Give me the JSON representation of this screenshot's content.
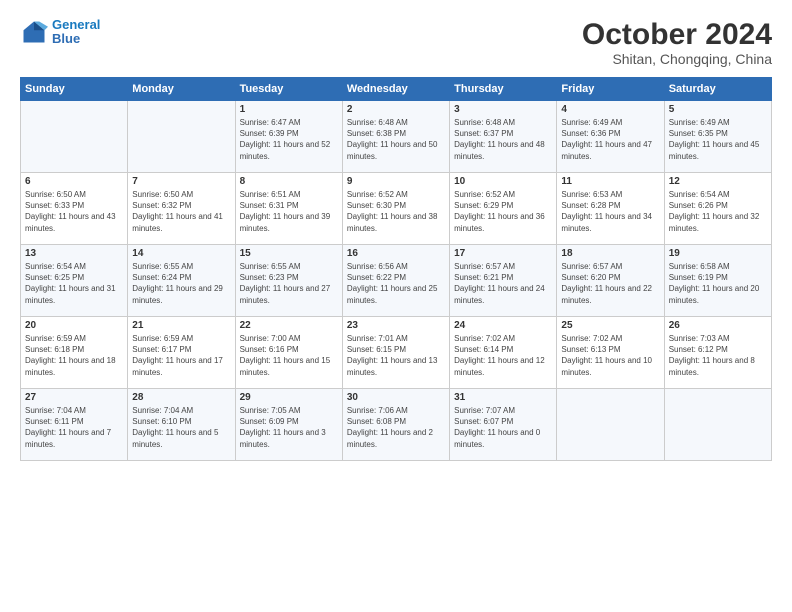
{
  "header": {
    "logo_line1": "General",
    "logo_line2": "Blue",
    "title": "October 2024",
    "subtitle": "Shitan, Chongqing, China"
  },
  "days_of_week": [
    "Sunday",
    "Monday",
    "Tuesday",
    "Wednesday",
    "Thursday",
    "Friday",
    "Saturday"
  ],
  "weeks": [
    [
      {
        "day": "",
        "info": ""
      },
      {
        "day": "",
        "info": ""
      },
      {
        "day": "1",
        "info": "Sunrise: 6:47 AM\nSunset: 6:39 PM\nDaylight: 11 hours and 52 minutes."
      },
      {
        "day": "2",
        "info": "Sunrise: 6:48 AM\nSunset: 6:38 PM\nDaylight: 11 hours and 50 minutes."
      },
      {
        "day": "3",
        "info": "Sunrise: 6:48 AM\nSunset: 6:37 PM\nDaylight: 11 hours and 48 minutes."
      },
      {
        "day": "4",
        "info": "Sunrise: 6:49 AM\nSunset: 6:36 PM\nDaylight: 11 hours and 47 minutes."
      },
      {
        "day": "5",
        "info": "Sunrise: 6:49 AM\nSunset: 6:35 PM\nDaylight: 11 hours and 45 minutes."
      }
    ],
    [
      {
        "day": "6",
        "info": "Sunrise: 6:50 AM\nSunset: 6:33 PM\nDaylight: 11 hours and 43 minutes."
      },
      {
        "day": "7",
        "info": "Sunrise: 6:50 AM\nSunset: 6:32 PM\nDaylight: 11 hours and 41 minutes."
      },
      {
        "day": "8",
        "info": "Sunrise: 6:51 AM\nSunset: 6:31 PM\nDaylight: 11 hours and 39 minutes."
      },
      {
        "day": "9",
        "info": "Sunrise: 6:52 AM\nSunset: 6:30 PM\nDaylight: 11 hours and 38 minutes."
      },
      {
        "day": "10",
        "info": "Sunrise: 6:52 AM\nSunset: 6:29 PM\nDaylight: 11 hours and 36 minutes."
      },
      {
        "day": "11",
        "info": "Sunrise: 6:53 AM\nSunset: 6:28 PM\nDaylight: 11 hours and 34 minutes."
      },
      {
        "day": "12",
        "info": "Sunrise: 6:54 AM\nSunset: 6:26 PM\nDaylight: 11 hours and 32 minutes."
      }
    ],
    [
      {
        "day": "13",
        "info": "Sunrise: 6:54 AM\nSunset: 6:25 PM\nDaylight: 11 hours and 31 minutes."
      },
      {
        "day": "14",
        "info": "Sunrise: 6:55 AM\nSunset: 6:24 PM\nDaylight: 11 hours and 29 minutes."
      },
      {
        "day": "15",
        "info": "Sunrise: 6:55 AM\nSunset: 6:23 PM\nDaylight: 11 hours and 27 minutes."
      },
      {
        "day": "16",
        "info": "Sunrise: 6:56 AM\nSunset: 6:22 PM\nDaylight: 11 hours and 25 minutes."
      },
      {
        "day": "17",
        "info": "Sunrise: 6:57 AM\nSunset: 6:21 PM\nDaylight: 11 hours and 24 minutes."
      },
      {
        "day": "18",
        "info": "Sunrise: 6:57 AM\nSunset: 6:20 PM\nDaylight: 11 hours and 22 minutes."
      },
      {
        "day": "19",
        "info": "Sunrise: 6:58 AM\nSunset: 6:19 PM\nDaylight: 11 hours and 20 minutes."
      }
    ],
    [
      {
        "day": "20",
        "info": "Sunrise: 6:59 AM\nSunset: 6:18 PM\nDaylight: 11 hours and 18 minutes."
      },
      {
        "day": "21",
        "info": "Sunrise: 6:59 AM\nSunset: 6:17 PM\nDaylight: 11 hours and 17 minutes."
      },
      {
        "day": "22",
        "info": "Sunrise: 7:00 AM\nSunset: 6:16 PM\nDaylight: 11 hours and 15 minutes."
      },
      {
        "day": "23",
        "info": "Sunrise: 7:01 AM\nSunset: 6:15 PM\nDaylight: 11 hours and 13 minutes."
      },
      {
        "day": "24",
        "info": "Sunrise: 7:02 AM\nSunset: 6:14 PM\nDaylight: 11 hours and 12 minutes."
      },
      {
        "day": "25",
        "info": "Sunrise: 7:02 AM\nSunset: 6:13 PM\nDaylight: 11 hours and 10 minutes."
      },
      {
        "day": "26",
        "info": "Sunrise: 7:03 AM\nSunset: 6:12 PM\nDaylight: 11 hours and 8 minutes."
      }
    ],
    [
      {
        "day": "27",
        "info": "Sunrise: 7:04 AM\nSunset: 6:11 PM\nDaylight: 11 hours and 7 minutes."
      },
      {
        "day": "28",
        "info": "Sunrise: 7:04 AM\nSunset: 6:10 PM\nDaylight: 11 hours and 5 minutes."
      },
      {
        "day": "29",
        "info": "Sunrise: 7:05 AM\nSunset: 6:09 PM\nDaylight: 11 hours and 3 minutes."
      },
      {
        "day": "30",
        "info": "Sunrise: 7:06 AM\nSunset: 6:08 PM\nDaylight: 11 hours and 2 minutes."
      },
      {
        "day": "31",
        "info": "Sunrise: 7:07 AM\nSunset: 6:07 PM\nDaylight: 11 hours and 0 minutes."
      },
      {
        "day": "",
        "info": ""
      },
      {
        "day": "",
        "info": ""
      }
    ]
  ]
}
